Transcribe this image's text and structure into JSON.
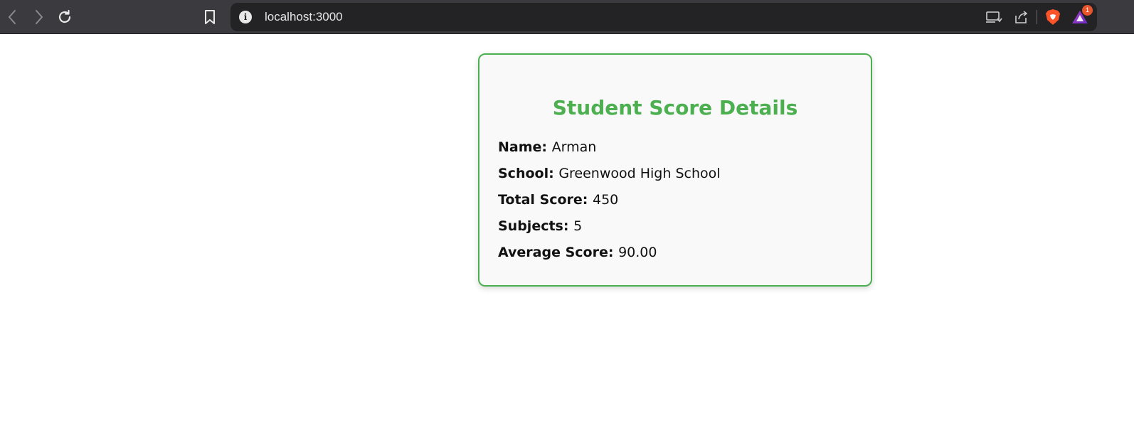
{
  "browser": {
    "url": "localhost:3000",
    "info_icon": "info-icon",
    "notification_count": "1",
    "icons": {
      "back": "chevron-left-icon",
      "forward": "chevron-right-icon",
      "reload": "reload-icon",
      "bookmark": "bookmark-icon",
      "cast": "cast-icon",
      "share": "share-icon",
      "brave": "brave-shield-icon",
      "rewards": "brave-rewards-icon"
    }
  },
  "card": {
    "title": "Student Score Details",
    "accent_color": "#4caf50",
    "fields": [
      {
        "label": "Name:",
        "value": "Arman"
      },
      {
        "label": "School:",
        "value": "Greenwood High School"
      },
      {
        "label": "Total Score:",
        "value": "450"
      },
      {
        "label": "Subjects:",
        "value": "5"
      },
      {
        "label": "Average Score:",
        "value": "90.00"
      }
    ]
  }
}
